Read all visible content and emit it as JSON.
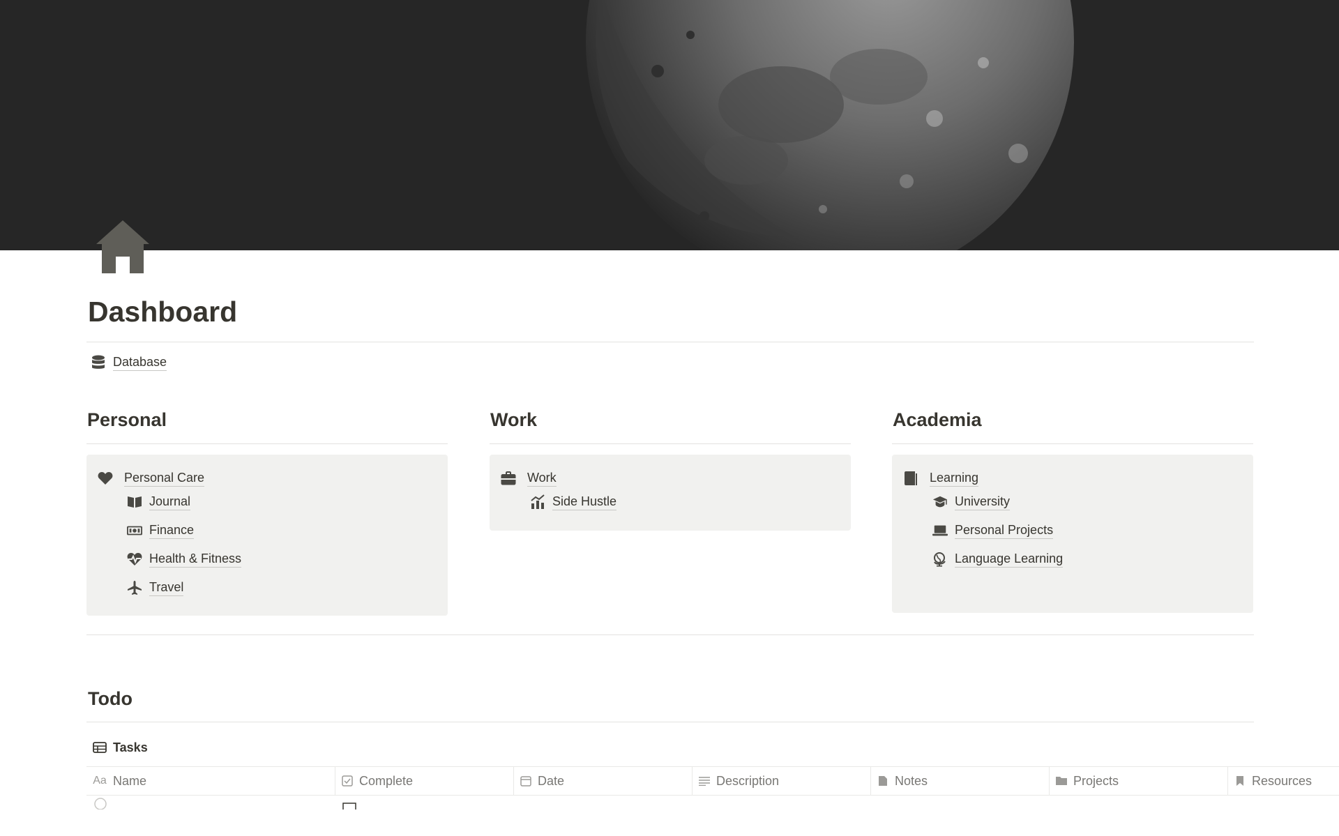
{
  "page": {
    "title": "Dashboard",
    "icon": "house-icon",
    "cover": "moon-cover-image"
  },
  "database_link": {
    "label": "Database",
    "icon": "database-icon"
  },
  "sections": [
    {
      "heading": "Personal",
      "main": {
        "label": "Personal Care",
        "icon": "heart-icon"
      },
      "items": [
        {
          "label": "Journal",
          "icon": "book-open-icon"
        },
        {
          "label": "Finance",
          "icon": "money-icon"
        },
        {
          "label": "Health & Fitness",
          "icon": "heartbeat-icon"
        },
        {
          "label": "Travel",
          "icon": "plane-icon"
        }
      ]
    },
    {
      "heading": "Work",
      "main": {
        "label": "Work",
        "icon": "briefcase-icon"
      },
      "items": [
        {
          "label": "Side Hustle",
          "icon": "chart-icon"
        }
      ]
    },
    {
      "heading": "Academia",
      "main": {
        "label": "Learning",
        "icon": "book-icon"
      },
      "items": [
        {
          "label": "University",
          "icon": "graduation-cap-icon"
        },
        {
          "label": "Personal Projects",
          "icon": "laptop-icon"
        },
        {
          "label": "Language Learning",
          "icon": "globe-icon"
        }
      ]
    }
  ],
  "todo": {
    "heading": "Todo",
    "view": {
      "label": "Tasks",
      "icon": "table-icon"
    },
    "columns": [
      {
        "label": "Name",
        "icon": "text-aa-icon"
      },
      {
        "label": "Complete",
        "icon": "checkbox-icon"
      },
      {
        "label": "Date",
        "icon": "calendar-icon"
      },
      {
        "label": "Description",
        "icon": "lines-icon"
      },
      {
        "label": "Notes",
        "icon": "file-icon"
      },
      {
        "label": "Projects",
        "icon": "folder-icon"
      },
      {
        "label": "Resources",
        "icon": "bookmark-icon"
      }
    ]
  }
}
